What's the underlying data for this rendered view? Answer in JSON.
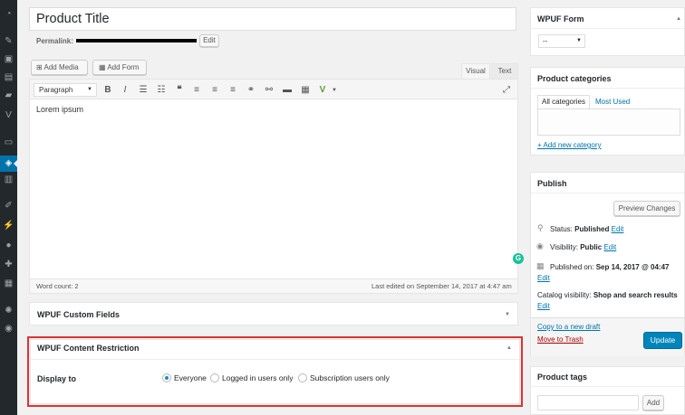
{
  "title": {
    "value": "Product Title"
  },
  "permalink": {
    "label": "Permalink:",
    "edit_label": "Edit"
  },
  "media_buttons": {
    "add_media": "Add Media",
    "add_form": "Add Form"
  },
  "editor": {
    "tab_visual": "Visual",
    "tab_text": "Text",
    "format_select": "Paragraph",
    "content": "Lorem ipsum",
    "word_count": "Word count: 2",
    "last_edited": "Last edited on September 14, 2017 at 4:47 am"
  },
  "custom_fields": {
    "title": "WPUF Custom Fields"
  },
  "content_restriction": {
    "title": "WPUF Content Restriction",
    "label": "Display to",
    "options": [
      "Everyone",
      "Logged in users only",
      "Subscription users only"
    ],
    "selected": "Everyone"
  },
  "wpuf_form": {
    "title": "WPUF Form",
    "select_value": "--"
  },
  "product_categories": {
    "title": "Product categories",
    "tab_all": "All categories",
    "tab_most_used": "Most Used",
    "add_new": "+ Add new category"
  },
  "publish": {
    "title": "Publish",
    "preview_label": "Preview Changes",
    "status_label": "Status:",
    "status_value": "Published",
    "visibility_label": "Visibility:",
    "visibility_value": "Public",
    "published_label": "Published on:",
    "published_value": "Sep 14, 2017 @ 04:47",
    "catalog_label": "Catalog visibility:",
    "catalog_value": "Shop and search results",
    "edit": "Edit",
    "copy_draft": "Copy to a new draft",
    "trash": "Move to Trash",
    "update": "Update"
  },
  "product_tags": {
    "title": "Product tags",
    "add_label": "Add"
  },
  "colors": {
    "accent": "#0073aa",
    "highlight_border": "#e03131",
    "primary_button": "#0085ba",
    "trash": "#a00",
    "sidebar": "#23282d",
    "grammarly": "#15c39a"
  }
}
